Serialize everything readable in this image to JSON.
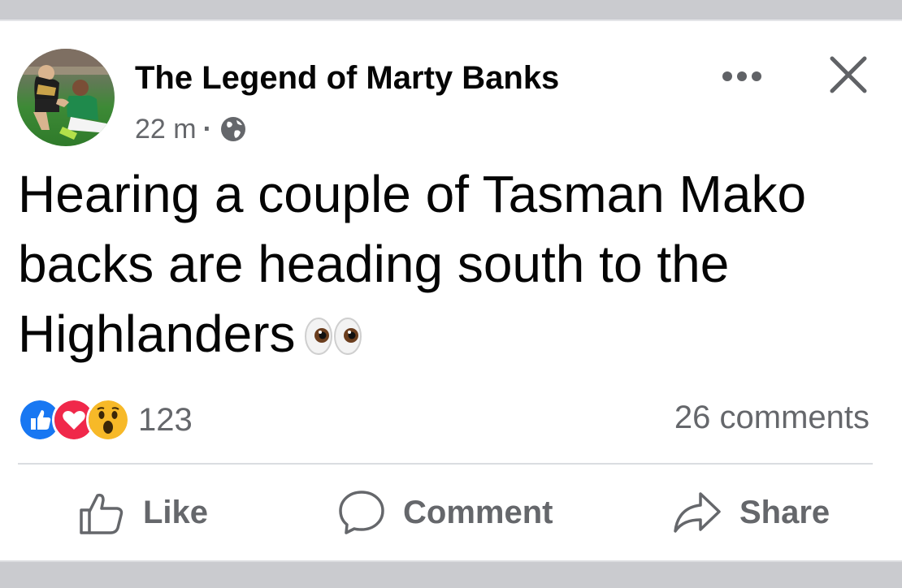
{
  "post": {
    "author": "The Legend of Marty Banks",
    "time": "22 m",
    "separator": "·",
    "visibility_icon": "globe-icon",
    "text": "Hearing a couple of Tasman Mako backs are heading south to the Highlanders",
    "emoji_icon": "eyes-icon",
    "reactions": {
      "icons": [
        "like-reaction-icon",
        "love-reaction-icon",
        "wow-reaction-icon"
      ],
      "count": "123"
    },
    "comments": "26 comments"
  },
  "actions": {
    "like": "Like",
    "comment": "Comment",
    "share": "Share"
  },
  "colors": {
    "text": "#050505",
    "secondary": "#65676b",
    "like_blue": "#1877f2",
    "love_red": "#f0284a",
    "wow_yellow": "#f7b928",
    "frame_gray": "#cacbcf"
  }
}
